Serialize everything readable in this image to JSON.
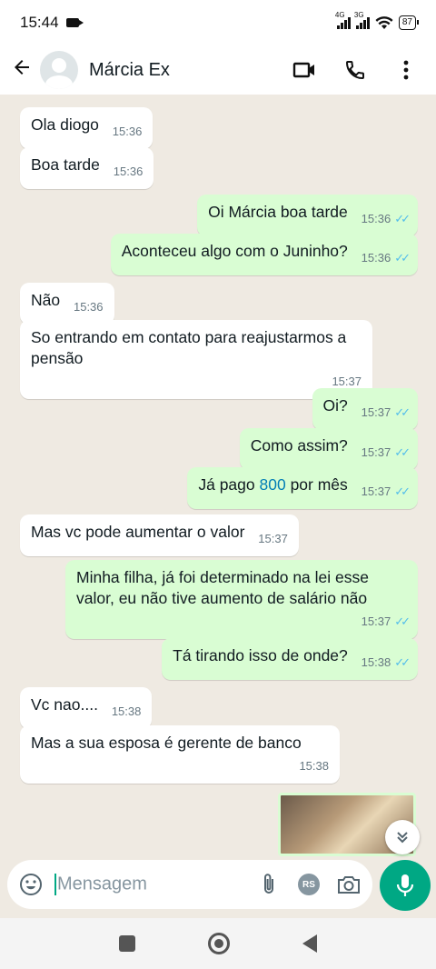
{
  "status_bar": {
    "time": "15:44",
    "network1": "4G",
    "network2": "3G",
    "battery": "87"
  },
  "header": {
    "contact_name": "Márcia Ex"
  },
  "messages": [
    {
      "dir": "in",
      "text": "Ola diogo",
      "time": "15:36"
    },
    {
      "dir": "in",
      "text": "Boa tarde",
      "time": "15:36"
    },
    {
      "dir": "out",
      "text": "Oi Márcia boa tarde",
      "time": "15:36",
      "ticks": "✓✓"
    },
    {
      "dir": "out",
      "text": "Aconteceu algo com o Juninho?",
      "time": "15:36",
      "ticks": "✓✓"
    },
    {
      "dir": "in",
      "text": "Não",
      "time": "15:36"
    },
    {
      "dir": "in",
      "text": "So entrando em contato para reajustarmos a pensão",
      "time": "15:37"
    },
    {
      "dir": "out",
      "text": "Oi?",
      "time": "15:37",
      "ticks": "✓✓"
    },
    {
      "dir": "out",
      "text": "Como assim?",
      "time": "15:37",
      "ticks": "✓✓"
    },
    {
      "dir": "out",
      "text_before": "Já pago ",
      "text_highlight": "800",
      "text_after": " por mês",
      "time": "15:37",
      "ticks": "✓✓"
    },
    {
      "dir": "in",
      "text": "Mas vc pode aumentar o valor",
      "time": "15:37"
    },
    {
      "dir": "out",
      "text": "Minha filha, já foi determinado na lei esse valor, eu não tive aumento de salário não",
      "time": "15:37",
      "ticks": "✓✓"
    },
    {
      "dir": "out",
      "text": "Tá tirando isso de onde?",
      "time": "15:38",
      "ticks": "✓✓"
    },
    {
      "dir": "in",
      "text": "Vc nao....",
      "time": "15:38"
    },
    {
      "dir": "in",
      "text": "Mas a sua esposa é gerente de banco",
      "time": "15:38"
    }
  ],
  "input": {
    "placeholder": "Mensagem",
    "rs_badge": "RS"
  },
  "colors": {
    "incoming": "#ffffff",
    "outgoing": "#d9fdd3",
    "accent": "#00a884",
    "ticks": "#53bdeb",
    "background": "#efeae2"
  },
  "icons": [
    "back-arrow-icon",
    "video-call-icon",
    "phone-icon",
    "more-options-icon",
    "emoji-icon",
    "attach-icon",
    "camera-icon",
    "mic-icon",
    "scroll-down-icon"
  ]
}
